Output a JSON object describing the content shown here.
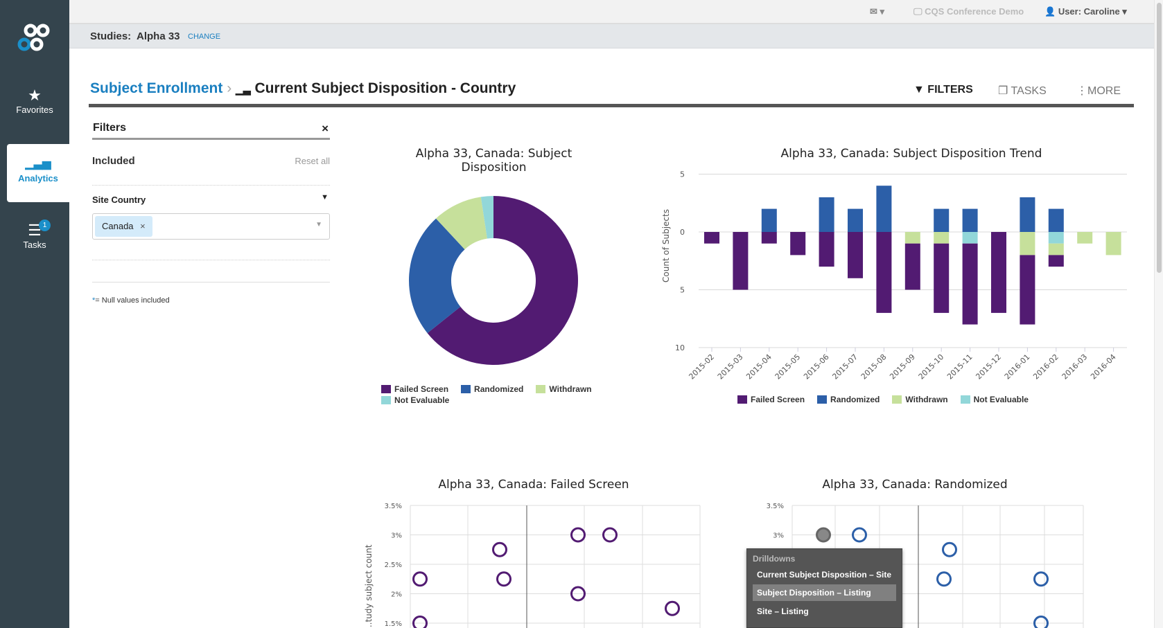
{
  "sidebar": {
    "items": [
      {
        "label": "Favorites",
        "icon": "star-icon"
      },
      {
        "label": "Analytics",
        "icon": "bar-chart-icon",
        "active": true
      },
      {
        "label": "Tasks",
        "icon": "tasks-icon",
        "badge": "1"
      }
    ]
  },
  "topbar": {
    "user": "User: Caroline",
    "workspace": "CQS Conference Demo"
  },
  "studies": {
    "label": "Studies:",
    "value": "Alpha 33",
    "change": "CHANGE"
  },
  "breadcrumb": {
    "parent": "Subject Enrollment",
    "current": "Current Subject Disposition - Country"
  },
  "toolbar": {
    "filters": "FILTERS",
    "tasks": "TASKS",
    "more": "MORE"
  },
  "filters": {
    "title": "Filters",
    "close": "×",
    "included": "Included",
    "reset": "Reset all",
    "field": "Site Country",
    "chip": "Canada",
    "chip_remove": "×",
    "note_star": "*",
    "note": "= Null values included"
  },
  "colors": {
    "failed_screen": "#521b72",
    "randomized": "#2c5fa8",
    "withdrawn": "#c6e09b",
    "not_evaluable": "#92d7d9",
    "accent": "#1a8fc9"
  },
  "chart_data": [
    {
      "type": "pie",
      "title": "Alpha 33, Canada: Subject Disposition",
      "donut": true,
      "categories": [
        "Failed Screen",
        "Randomized",
        "Withdrawn",
        "Not Evaluable"
      ],
      "values": [
        54,
        20,
        8,
        2
      ],
      "legend": "bottom"
    },
    {
      "type": "bar",
      "stacked": true,
      "title": "Alpha 33, Canada: Subject Disposition Trend",
      "ylabel": "Count of Subjects",
      "yticks": [
        "5",
        "0",
        "5",
        "10"
      ],
      "ylim": [
        -10,
        5
      ],
      "legend": "bottom",
      "grid": true,
      "categories": [
        "2015-02",
        "2015-03",
        "2015-04",
        "2015-05",
        "2015-06",
        "2015-07",
        "2015-08",
        "2015-09",
        "2015-10",
        "2015-11",
        "2015-12",
        "2016-01",
        "2016-02",
        "2016-03",
        "2016-04"
      ],
      "series": [
        {
          "name": "Failed Screen",
          "values": [
            -1,
            -5,
            -1,
            -2,
            -3,
            -4,
            -7,
            -4,
            -6,
            -7,
            -7,
            -6,
            -1,
            0,
            0
          ]
        },
        {
          "name": "Randomized",
          "values": [
            0,
            0,
            2,
            0,
            3,
            2,
            4,
            0,
            2,
            2,
            0,
            3,
            2,
            0,
            0
          ]
        },
        {
          "name": "Withdrawn",
          "values": [
            0,
            0,
            0,
            0,
            0,
            0,
            0,
            -1,
            -1,
            0,
            0,
            -2,
            -1,
            -1,
            -2
          ]
        },
        {
          "name": "Not Evaluable",
          "values": [
            0,
            0,
            0,
            0,
            0,
            0,
            0,
            0,
            0,
            -1,
            0,
            0,
            -1,
            0,
            0
          ]
        }
      ]
    },
    {
      "type": "scatter",
      "title": "Alpha 33, Canada: Failed Screen",
      "ylabel": "...tudy subject count",
      "yticks": [
        "3.5%",
        "3%",
        "2.5%",
        "2%",
        "1.5%"
      ],
      "y": [
        2.25,
        2.75,
        2.25,
        3,
        3,
        2,
        1.75,
        1.5
      ]
    },
    {
      "type": "scatter",
      "title": "Alpha 33, Canada: Randomized",
      "yticks": [
        "3.5%",
        "3%",
        "2.5%",
        "2%",
        "1.5%"
      ],
      "y": [
        3,
        3,
        2.75,
        2.25,
        2.25,
        1.5
      ]
    }
  ],
  "tooltip": {
    "header": "Drilldowns",
    "items": [
      "Current Subject Disposition – Site",
      "Subject Disposition – Listing",
      "Site – Listing"
    ],
    "highlighted": 1
  }
}
